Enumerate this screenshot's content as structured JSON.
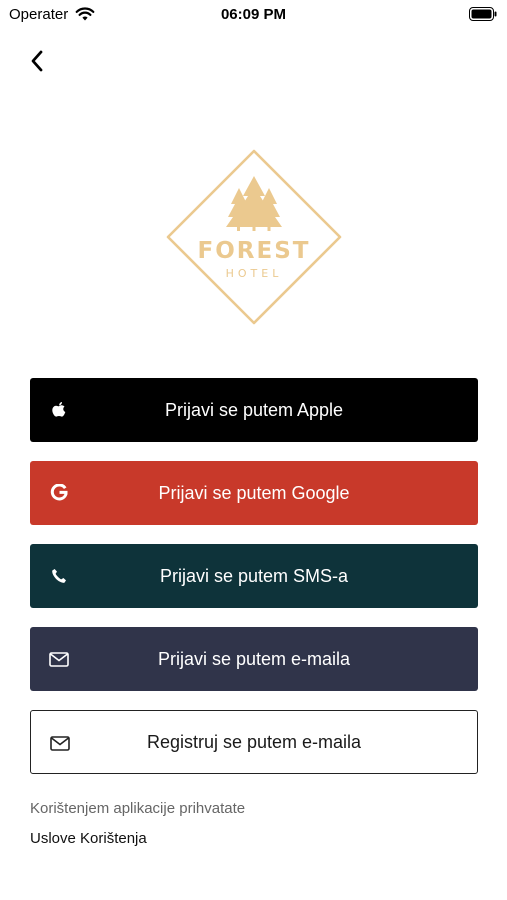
{
  "status_bar": {
    "carrier": "Operater",
    "time": "06:09 PM"
  },
  "logo": {
    "name": "FOREST",
    "subtitle": "HOTEL",
    "color": "#ebc98f"
  },
  "buttons": {
    "apple": {
      "label": "Prijavi se putem Apple",
      "icon": "apple-icon",
      "color": "#000000"
    },
    "google": {
      "label": "Prijavi se putem Google",
      "icon": "google-icon",
      "color": "#c8392a"
    },
    "sms": {
      "label": "Prijavi se putem SMS-a",
      "icon": "phone-icon",
      "color": "#0e333a"
    },
    "email_login": {
      "label": "Prijavi se putem e-maila",
      "icon": "envelope-icon",
      "color": "#30344a"
    },
    "email_register": {
      "label": "Registruj se putem e-maila",
      "icon": "envelope-icon",
      "color": "#ffffff"
    }
  },
  "terms": {
    "intro": "Korištenjem aplikacije prihvatate",
    "link": "Uslove Korištenja"
  }
}
